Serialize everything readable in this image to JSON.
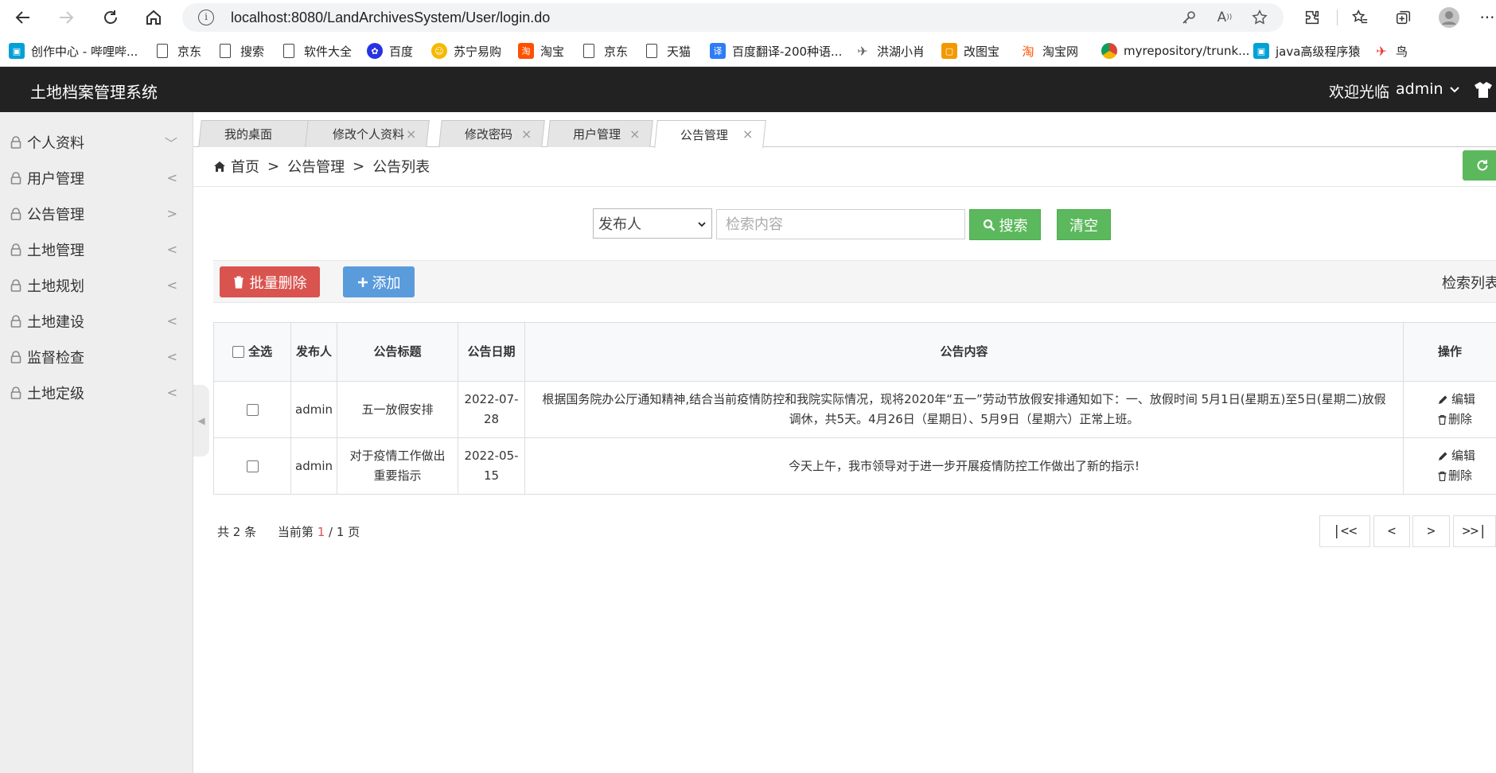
{
  "browser": {
    "url": "localhost:8080/LandArchivesSystem/User/login.do"
  },
  "bookmarks": [
    {
      "label": "创作中心 - 哔哩哔...",
      "icon": "bilibili-icon"
    },
    {
      "label": "京东",
      "icon": "page-icon"
    },
    {
      "label": "搜索",
      "icon": "page-icon"
    },
    {
      "label": "软件大全",
      "icon": "page-icon"
    },
    {
      "label": "百度",
      "icon": "baidu-icon"
    },
    {
      "label": "苏宁易购",
      "icon": "suning-icon"
    },
    {
      "label": "淘宝",
      "icon": "taobao-icon"
    },
    {
      "label": "京东",
      "icon": "page-icon"
    },
    {
      "label": "天猫",
      "icon": "page-icon"
    },
    {
      "label": "百度翻译-200种语...",
      "icon": "baidu-translate-icon"
    },
    {
      "label": "洪湖小肖",
      "icon": "bird-icon"
    },
    {
      "label": "改图宝",
      "icon": "gaitubao-icon"
    },
    {
      "label": "淘宝网",
      "icon": "taobao-icon"
    },
    {
      "label": "myrepository/trunk...",
      "icon": "chrome-icon"
    },
    {
      "label": "java高级程序猿",
      "icon": "bilibili-icon"
    },
    {
      "label": "鸟",
      "icon": "bird-icon"
    }
  ],
  "header": {
    "title": "土地档案管理系统",
    "welcome": "欢迎光临",
    "username": "admin"
  },
  "sidebar": {
    "items": [
      {
        "label": "个人资料",
        "arrow": "﹀"
      },
      {
        "label": "用户管理",
        "arrow": "<"
      },
      {
        "label": "公告管理",
        "arrow": ">"
      },
      {
        "label": "土地管理",
        "arrow": "<"
      },
      {
        "label": "土地规划",
        "arrow": "<"
      },
      {
        "label": "土地建设",
        "arrow": "<"
      },
      {
        "label": "监督检查",
        "arrow": "<"
      },
      {
        "label": "土地定级",
        "arrow": "<"
      }
    ]
  },
  "tabs": [
    {
      "label": "我的桌面",
      "close": ""
    },
    {
      "label": "修改个人资料",
      "close": "×"
    },
    {
      "label": "修改密码",
      "close": "×"
    },
    {
      "label": "用户管理",
      "close": "×"
    },
    {
      "label": "公告管理",
      "close": "×"
    }
  ],
  "breadcrumb": {
    "home": "首页",
    "sep": ">",
    "level1": "公告管理",
    "level2": "公告列表"
  },
  "search": {
    "select_value": "发布人",
    "placeholder": "检索内容",
    "search_label": "搜索",
    "clear_label": "清空"
  },
  "toolbar": {
    "batch_delete_label": "批量删除",
    "add_label": "添加",
    "list_label": "检索列表"
  },
  "table": {
    "headers": {
      "select_all": "全选",
      "publisher": "发布人",
      "title": "公告标题",
      "date": "公告日期",
      "content": "公告内容",
      "actions": "操作"
    },
    "rows": [
      {
        "publisher": "admin",
        "title": "五一放假安排",
        "date": "2022-07-28",
        "content": "根据国务院办公厅通知精神,结合当前疫情防控和我院实际情况，现将2020年“五一”劳动节放假安排通知如下：一、放假时间 5月1日(星期五)至5日(星期二)放假调休，共5天。4月26日（星期日）、5月9日（星期六）正常上班。"
      },
      {
        "publisher": "admin",
        "title": "对于疫情工作做出重要指示",
        "date": "2022-05-15",
        "content": "今天上午，我市领导对于进一步开展疫情防控工作做出了新的指示!"
      }
    ],
    "edit_label": "编辑",
    "delete_label": "删除"
  },
  "pagination": {
    "total_prefix": "共",
    "total": "2",
    "total_suffix": "条",
    "page_prefix": "当前第",
    "current": "1",
    "page_sep": "/",
    "pages": "1",
    "page_suffix": "页",
    "first": "|<<",
    "prev": "<",
    "next": ">",
    "last": ">>|"
  },
  "colors": {
    "header_bg": "#222222",
    "success": "#5cb85c",
    "danger": "#d9534f",
    "primary": "#5a9bdc"
  }
}
